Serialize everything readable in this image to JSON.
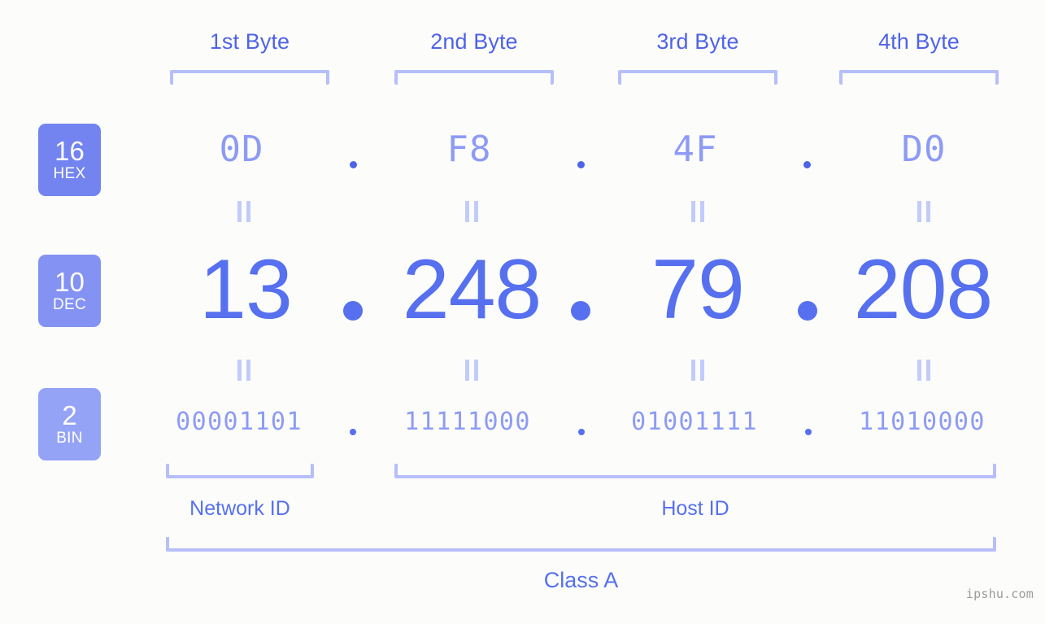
{
  "page": {
    "background_color": "#fcfdfa",
    "accent_color": "#5670ef",
    "light_accent_color": "#8d9bf5",
    "bracket_color": "#b6bffa",
    "watermark": "ipshu.com"
  },
  "byte_headers": [
    {
      "label": "1st Byte"
    },
    {
      "label": "2nd Byte"
    },
    {
      "label": "3rd Byte"
    },
    {
      "label": "4th Byte"
    }
  ],
  "bases": [
    {
      "number": "16",
      "name": "HEX",
      "color": "#7384f0"
    },
    {
      "number": "10",
      "name": "DEC",
      "color": "#8492f3"
    },
    {
      "number": "2",
      "name": "BIN",
      "color": "#94a3f6"
    }
  ],
  "separator": ".",
  "equals_symbol": "=",
  "rows": {
    "hex": {
      "base_label": "HEX",
      "base_number": "16",
      "values": [
        "0D",
        "F8",
        "4F",
        "D0"
      ]
    },
    "dec": {
      "base_label": "DEC",
      "base_number": "10",
      "values": [
        "13",
        "248",
        "79",
        "208"
      ]
    },
    "bin": {
      "base_label": "BIN",
      "base_number": "2",
      "values": [
        "00001101",
        "11111000",
        "01001111",
        "11010000"
      ]
    }
  },
  "segments": {
    "network_id": "Network ID",
    "host_id": "Host ID"
  },
  "class": {
    "label": "Class A"
  },
  "ip_address": "13.248.79.208"
}
